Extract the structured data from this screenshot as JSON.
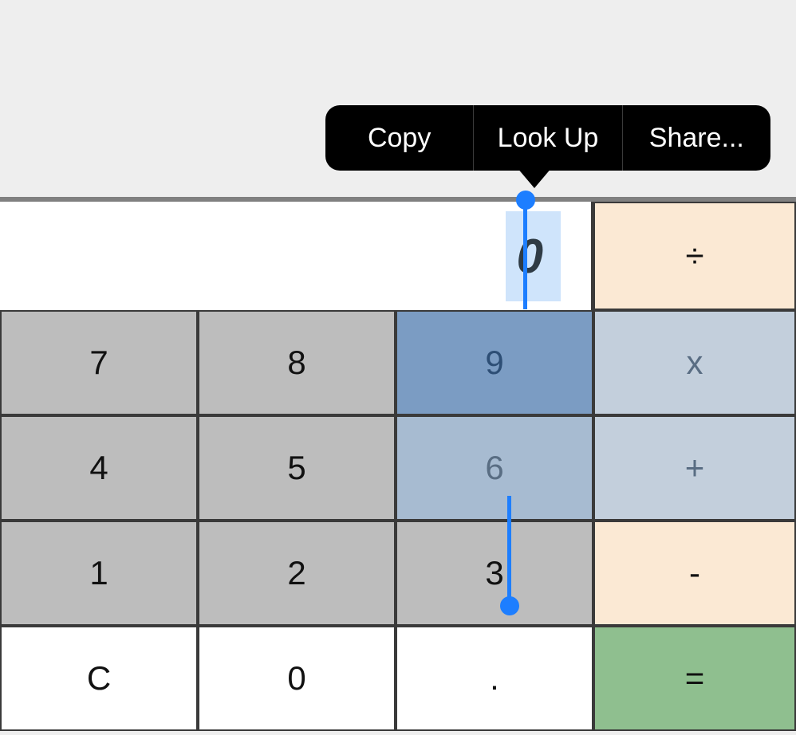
{
  "context_menu": {
    "copy": "Copy",
    "lookup": "Look Up",
    "share": "Share..."
  },
  "display": {
    "value": "0"
  },
  "operators": {
    "divide": "÷",
    "multiply": "x",
    "add": "+",
    "subtract": "-",
    "equals": "="
  },
  "keys": {
    "k7": "7",
    "k8": "8",
    "k9": "9",
    "k4": "4",
    "k5": "5",
    "k6": "6",
    "k1": "1",
    "k2": "2",
    "k3": "3",
    "clear": "C",
    "k0": "0",
    "dot": "."
  }
}
